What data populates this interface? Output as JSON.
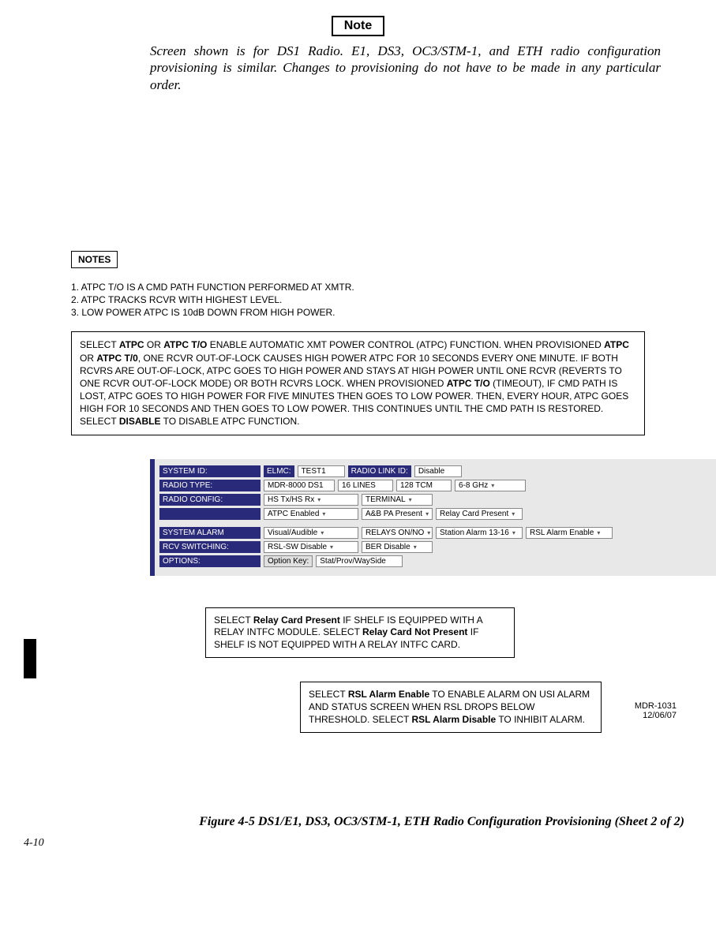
{
  "noteTag": "Note",
  "noteText": "Screen shown is for DS1 Radio. E1, DS3, OC3/STM-1, and ETH radio configuration provisioning is similar. Changes to provisioning do not have to be made in any particular order.",
  "notesTag": "NOTES",
  "notesList": {
    "n1": "1. ATPC T/O IS A CMD PATH FUNCTION PERFORMED AT XMTR.",
    "n2": "2. ATPC TRACKS RCVR WITH HIGHEST LEVEL.",
    "n3": "3. LOW POWER ATPC IS 10dB DOWN FROM HIGH POWER."
  },
  "calloutMain": {
    "p1a": "SELECT ",
    "p1b": "ATPC",
    "p1c": " OR ",
    "p1d": "ATPC T/O",
    "p1e": " ENABLE AUTOMATIC XMT POWER CONTROL (ATPC) FUNCTION. WHEN PROVISIONED ",
    "p1f": "ATPC",
    "p1g": " OR ",
    "p1h": "ATPC T/0",
    "p1i": ", ONE RCVR OUT-OF-LOCK CAUSES HIGH POWER ATPC FOR 10 SECONDS EVERY ONE MINUTE. IF BOTH RCVRS ARE OUT-OF-LOCK, ATPC GOES TO HIGH POWER AND STAYS AT HIGH POWER UNTIL ONE RCVR (REVERTS TO ONE RCVR OUT-OF-LOCK MODE) OR BOTH RCVRS LOCK. WHEN PROVISIONED ",
    "p1j": "ATPC T/O",
    "p1k": " (TIMEOUT), IF CMD PATH IS LOST, ATPC GOES TO HIGH POWER FOR FIVE MINUTES THEN GOES TO LOW POWER. THEN, EVERY HOUR, ATPC GOES HIGH FOR 10 SECONDS AND THEN GOES TO LOW POWER. THIS CONTINUES UNTIL THE CMD PATH IS RESTORED. SELECT ",
    "p1l": "DISABLE",
    "p1m": " TO DISABLE ATPC FUNCTION."
  },
  "panel": {
    "systemIdLabel": "SYSTEM ID:",
    "elmcLabel": "ELMC:",
    "elmcValue": "TEST1",
    "radioLinkIdLabel": "RADIO LINK ID:",
    "radioLinkIdValue": "Disable",
    "radioTypeLabel": "RADIO TYPE:",
    "radioTypeValues": {
      "v1": "MDR-8000 DS1",
      "v2": "16 LINES",
      "v3": "128 TCM",
      "v4": "6-8 GHz"
    },
    "radioConfigLabel": "RADIO CONFIG:",
    "radioConfigRow1": {
      "v1": "HS Tx/HS Rx",
      "v2": "TERMINAL"
    },
    "radioConfigRow2": {
      "v1": "ATPC Enabled",
      "v2": "A&B PA Present",
      "v3": "Relay Card Present"
    },
    "systemAlarmLabel": "SYSTEM ALARM",
    "systemAlarmValues": {
      "v1": "Visual/Audible",
      "v2": "RELAYS ON/NO",
      "v3": "Station Alarm 13-16",
      "v4": "RSL Alarm Enable"
    },
    "rcvSwitchingLabel": "RCV SWITCHING:",
    "rcvSwitchingValues": {
      "v1": "RSL-SW Disable",
      "v2": "BER Disable"
    },
    "optionsLabel": "OPTIONS:",
    "optionKeyLabel": "Option Key:",
    "optionKeyValue": "Stat/Prov/WaySide"
  },
  "calloutRelay": {
    "a": "SELECT ",
    "b": "Relay Card Present",
    "c": " IF SHELF IS EQUIPPED WITH A RELAY INTFC MODULE. SELECT ",
    "d": "Relay Card Not Present",
    "e": " IF SHELF IS NOT EQUIPPED WITH A RELAY INTFC CARD."
  },
  "calloutRsl": {
    "a": "SELECT ",
    "b": "RSL Alarm Enable",
    "c": " TO ENABLE ALARM ON USI ALARM AND STATUS SCREEN WHEN RSL DROPS BELOW THRESHOLD. SELECT ",
    "d": "RSL Alarm Disable",
    "e": " TO INHIBIT ALARM."
  },
  "ref": {
    "l1": "MDR-1031",
    "l2": "12/06/07"
  },
  "figureCaption": "Figure 4-5  DS1/E1, DS3, OC3/STM-1, ETH Radio Configuration Provisioning (Sheet 2 of 2)",
  "pageNum": "4-10"
}
